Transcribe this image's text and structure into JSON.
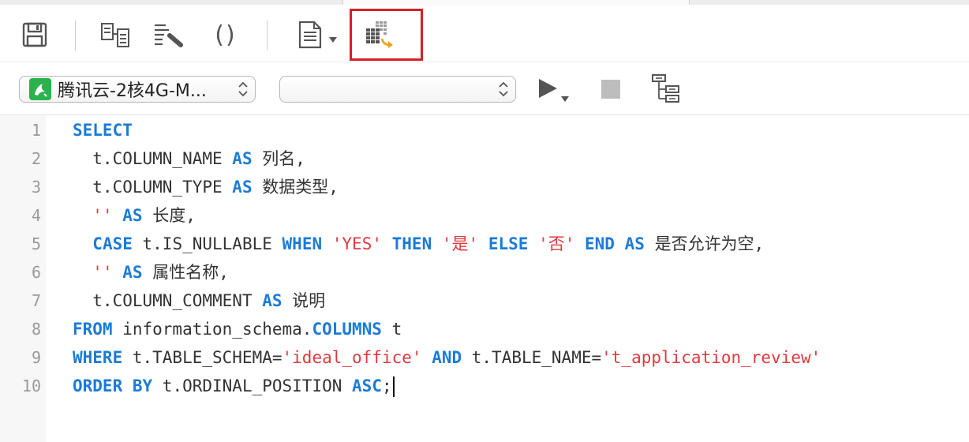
{
  "toolbar": {
    "buttons": [
      {
        "name": "save-icon"
      },
      {
        "name": "query-builder-icon"
      },
      {
        "name": "beautify-sql-icon"
      },
      {
        "name": "code-snippet-icon"
      },
      {
        "name": "text-view-icon"
      },
      {
        "name": "export-result-icon"
      }
    ],
    "parentheses_glyph": "()",
    "highlight_color": "#d62024"
  },
  "querybar": {
    "connection": "腾讯云-2核4G-M...",
    "database": "",
    "connection_icon_color": "#2bb24c"
  },
  "editor": {
    "lines": [
      {
        "n": "1",
        "tokens": [
          [
            "kw",
            "SELECT"
          ]
        ]
      },
      {
        "n": "2",
        "tokens": [
          [
            "tx",
            "  t.COLUMN_NAME "
          ],
          [
            "kw",
            "AS"
          ],
          [
            "tx",
            " "
          ],
          [
            "cn",
            "列名"
          ],
          [
            "tx",
            ","
          ]
        ]
      },
      {
        "n": "3",
        "tokens": [
          [
            "tx",
            "  t.COLUMN_TYPE "
          ],
          [
            "kw",
            "AS"
          ],
          [
            "tx",
            " "
          ],
          [
            "cn",
            "数据类型"
          ],
          [
            "tx",
            ","
          ]
        ]
      },
      {
        "n": "4",
        "tokens": [
          [
            "tx",
            "  "
          ],
          [
            "str",
            "''"
          ],
          [
            "tx",
            " "
          ],
          [
            "kw",
            "AS"
          ],
          [
            "tx",
            " "
          ],
          [
            "cn",
            "长度"
          ],
          [
            "tx",
            ","
          ]
        ]
      },
      {
        "n": "5",
        "tokens": [
          [
            "tx",
            "  "
          ],
          [
            "kw",
            "CASE"
          ],
          [
            "tx",
            " t.IS_NULLABLE "
          ],
          [
            "kw",
            "WHEN"
          ],
          [
            "tx",
            " "
          ],
          [
            "str",
            "'YES'"
          ],
          [
            "tx",
            " "
          ],
          [
            "kw",
            "THEN"
          ],
          [
            "tx",
            " "
          ],
          [
            "str",
            "'是'"
          ],
          [
            "tx",
            " "
          ],
          [
            "kw",
            "ELSE"
          ],
          [
            "tx",
            " "
          ],
          [
            "str",
            "'否'"
          ],
          [
            "tx",
            " "
          ],
          [
            "kw",
            "END"
          ],
          [
            "tx",
            " "
          ],
          [
            "kw",
            "AS"
          ],
          [
            "tx",
            " "
          ],
          [
            "cn",
            "是否允许为空"
          ],
          [
            "tx",
            ","
          ]
        ]
      },
      {
        "n": "6",
        "tokens": [
          [
            "tx",
            "  "
          ],
          [
            "str",
            "''"
          ],
          [
            "tx",
            " "
          ],
          [
            "kw",
            "AS"
          ],
          [
            "tx",
            " "
          ],
          [
            "cn",
            "属性名称"
          ],
          [
            "tx",
            ","
          ]
        ]
      },
      {
        "n": "7",
        "tokens": [
          [
            "tx",
            "  t.COLUMN_COMMENT "
          ],
          [
            "kw",
            "AS"
          ],
          [
            "tx",
            " "
          ],
          [
            "cn",
            "说明"
          ]
        ]
      },
      {
        "n": "8",
        "tokens": [
          [
            "kw",
            "FROM"
          ],
          [
            "tx",
            " information_schema."
          ],
          [
            "kw",
            "COLUMNS"
          ],
          [
            "tx",
            " t"
          ]
        ]
      },
      {
        "n": "9",
        "tokens": [
          [
            "kw",
            "WHERE"
          ],
          [
            "tx",
            " t.TABLE_SCHEMA="
          ],
          [
            "str",
            "'ideal_office'"
          ],
          [
            "tx",
            " "
          ],
          [
            "kw",
            "AND"
          ],
          [
            "tx",
            " t.TABLE_NAME="
          ],
          [
            "str",
            "'t_application_review'"
          ]
        ]
      },
      {
        "n": "10",
        "tokens": [
          [
            "kw",
            "ORDER BY"
          ],
          [
            "tx",
            " t.ORDINAL_POSITION "
          ],
          [
            "kw",
            "ASC"
          ],
          [
            "tx",
            ";"
          ]
        ]
      }
    ],
    "colors": {
      "keyword": "#1c7bd6",
      "string": "#e0393e",
      "text": "#333333",
      "line_number": "#9a9a9a"
    }
  }
}
